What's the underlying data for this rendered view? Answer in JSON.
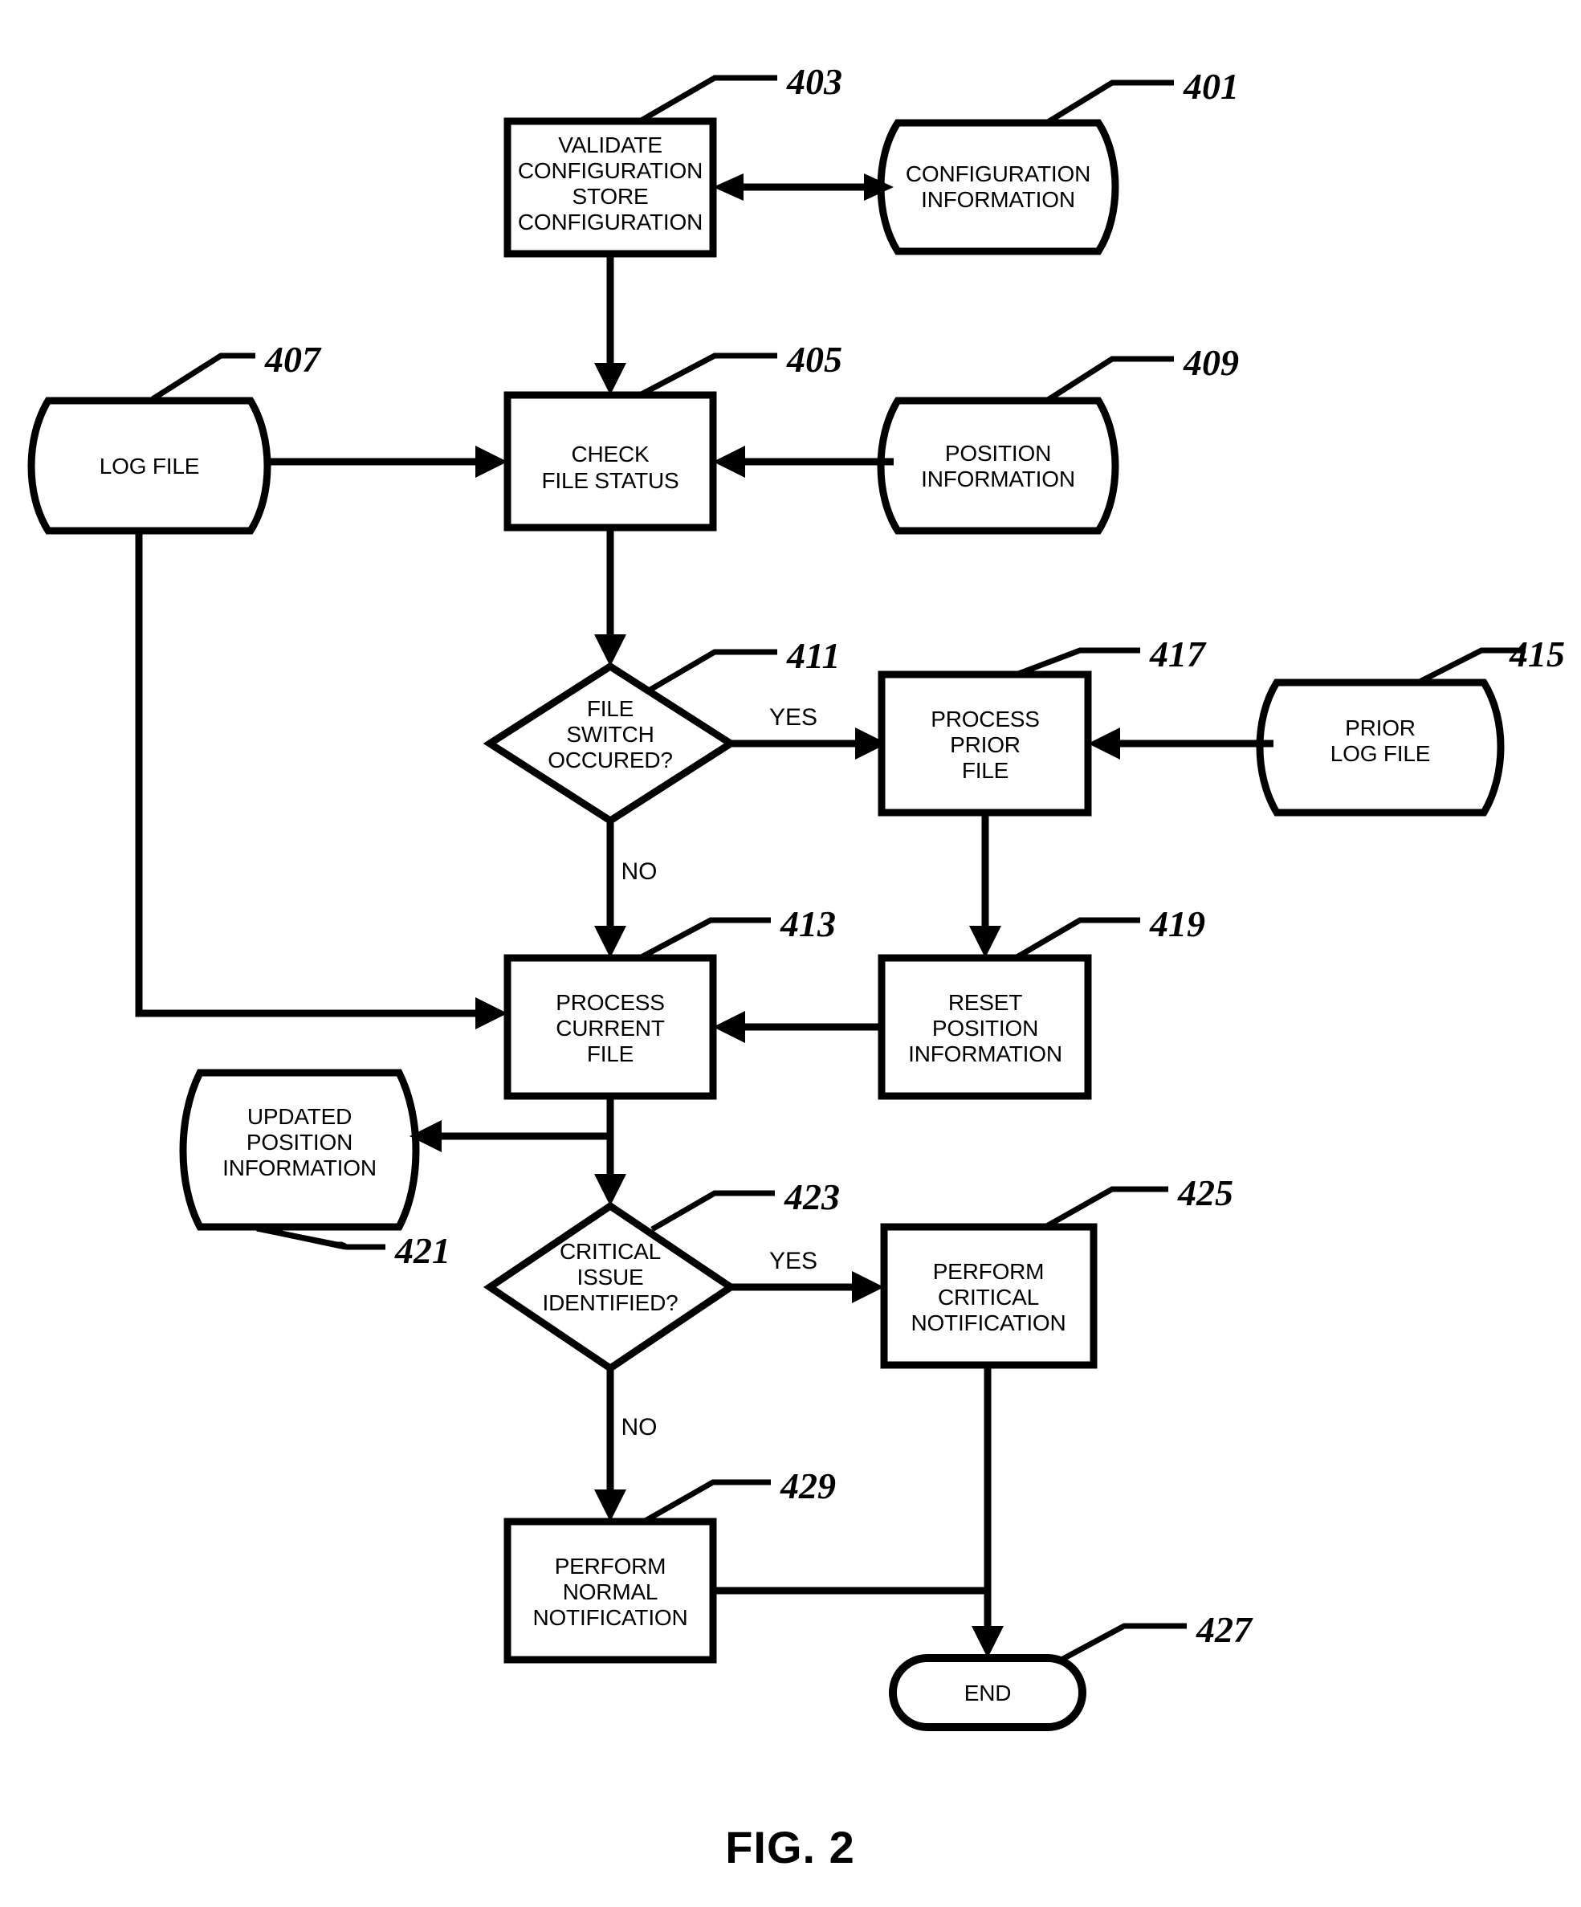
{
  "figure": {
    "caption": "FIG. 2"
  },
  "nodes": [
    {
      "id": "n401",
      "ref": "401",
      "shape": "data-store",
      "lines": [
        "CONFIGURATION",
        "INFORMATION"
      ]
    },
    {
      "id": "n403",
      "ref": "403",
      "shape": "process",
      "lines": [
        "VALIDATE",
        "CONFIGURATION",
        "STORE",
        "CONFIGURATION"
      ]
    },
    {
      "id": "n405",
      "ref": "405",
      "shape": "process",
      "lines": [
        "CHECK",
        "FILE STATUS"
      ]
    },
    {
      "id": "n407",
      "ref": "407",
      "shape": "data-store",
      "lines": [
        "LOG FILE"
      ]
    },
    {
      "id": "n409",
      "ref": "409",
      "shape": "data-store",
      "lines": [
        "POSITION",
        "INFORMATION"
      ]
    },
    {
      "id": "n411",
      "ref": "411",
      "shape": "decision",
      "lines": [
        "FILE",
        "SWITCH",
        "OCCURED?"
      ]
    },
    {
      "id": "n413",
      "ref": "413",
      "shape": "process",
      "lines": [
        "PROCESS",
        "CURRENT",
        "FILE"
      ]
    },
    {
      "id": "n415",
      "ref": "415",
      "shape": "data-store",
      "lines": [
        "PRIOR",
        "LOG FILE"
      ]
    },
    {
      "id": "n417",
      "ref": "417",
      "shape": "process",
      "lines": [
        "PROCESS",
        "PRIOR",
        "FILE"
      ]
    },
    {
      "id": "n419",
      "ref": "419",
      "shape": "process",
      "lines": [
        "RESET",
        "POSITION",
        "INFORMATION"
      ]
    },
    {
      "id": "n421",
      "ref": "421",
      "shape": "data-store",
      "lines": [
        "UPDATED",
        "POSITION",
        "INFORMATION"
      ]
    },
    {
      "id": "n423",
      "ref": "423",
      "shape": "decision",
      "lines": [
        "CRITICAL",
        "ISSUE",
        "IDENTIFIED?"
      ]
    },
    {
      "id": "n425",
      "ref": "425",
      "shape": "process",
      "lines": [
        "PERFORM",
        "CRITICAL",
        "NOTIFICATION"
      ]
    },
    {
      "id": "n427",
      "ref": "427",
      "shape": "terminator",
      "lines": [
        "END"
      ]
    },
    {
      "id": "n429",
      "ref": "429",
      "shape": "process",
      "lines": [
        "PERFORM",
        "NORMAL",
        "NOTIFICATION"
      ]
    }
  ],
  "branch_labels": {
    "file_switch_yes": "YES",
    "file_switch_no": "NO",
    "critical_issue_yes": "YES",
    "critical_issue_no": "NO"
  },
  "colors": {
    "stroke": "#000000",
    "fill": "#ffffff",
    "background": "#ffffff"
  }
}
